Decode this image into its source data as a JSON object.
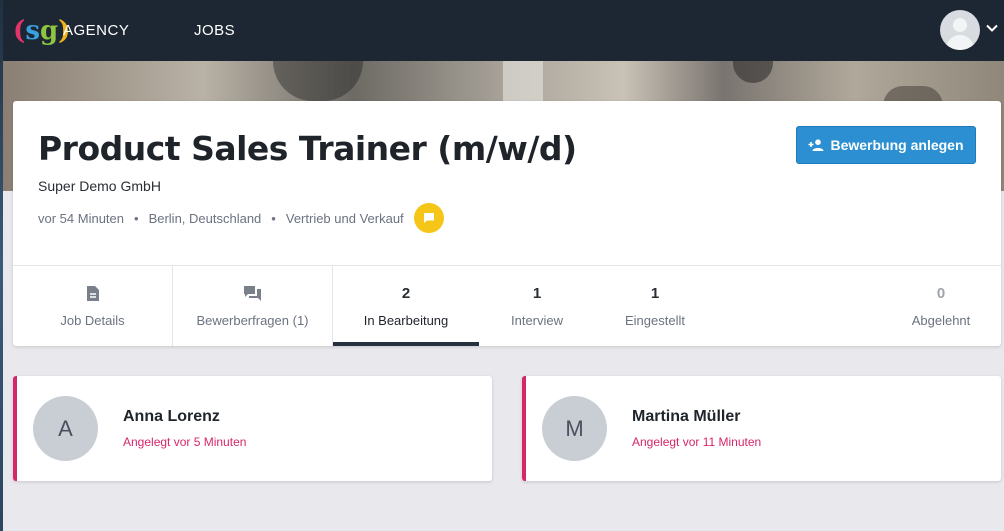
{
  "nav": {
    "logo": {
      "open": "(",
      "s": "s",
      "g": "g",
      "close": ")"
    },
    "agency_label": "AGENCY",
    "jobs_label": "JOBS"
  },
  "job": {
    "title": "Product Sales Trainer (m/w/d)",
    "company": "Super Demo GmbH",
    "meta": {
      "posted": "vor 54 Minuten",
      "location": "Berlin, Deutschland",
      "category": "Vertrieb und Verkauf",
      "separator": "•"
    },
    "create_button_label": "Bewerbung anlegen"
  },
  "tabs": [
    {
      "label": "Job Details",
      "icon": "document-icon"
    },
    {
      "label": "Bewerberfragen (1)",
      "icon": "chat-bubbles-icon"
    },
    {
      "label": "In Bearbeitung",
      "count": "2",
      "active": true
    },
    {
      "label": "Interview",
      "count": "1"
    },
    {
      "label": "Eingestellt",
      "count": "1"
    },
    {
      "label": "Abgelehnt",
      "count": "0"
    }
  ],
  "candidates": [
    {
      "initial": "A",
      "name": "Anna Lorenz",
      "created": "Angelegt vor 5 Minuten"
    },
    {
      "initial": "M",
      "name": "Martina Müller",
      "created": "Angelegt vor 11 Minuten"
    }
  ],
  "colors": {
    "nav_bg": "#1d2733",
    "primary_button": "#2b8fd1",
    "chat_badge": "#f5c518",
    "candidate_accent": "#d6266a",
    "active_tab_underline": "#26313f"
  }
}
